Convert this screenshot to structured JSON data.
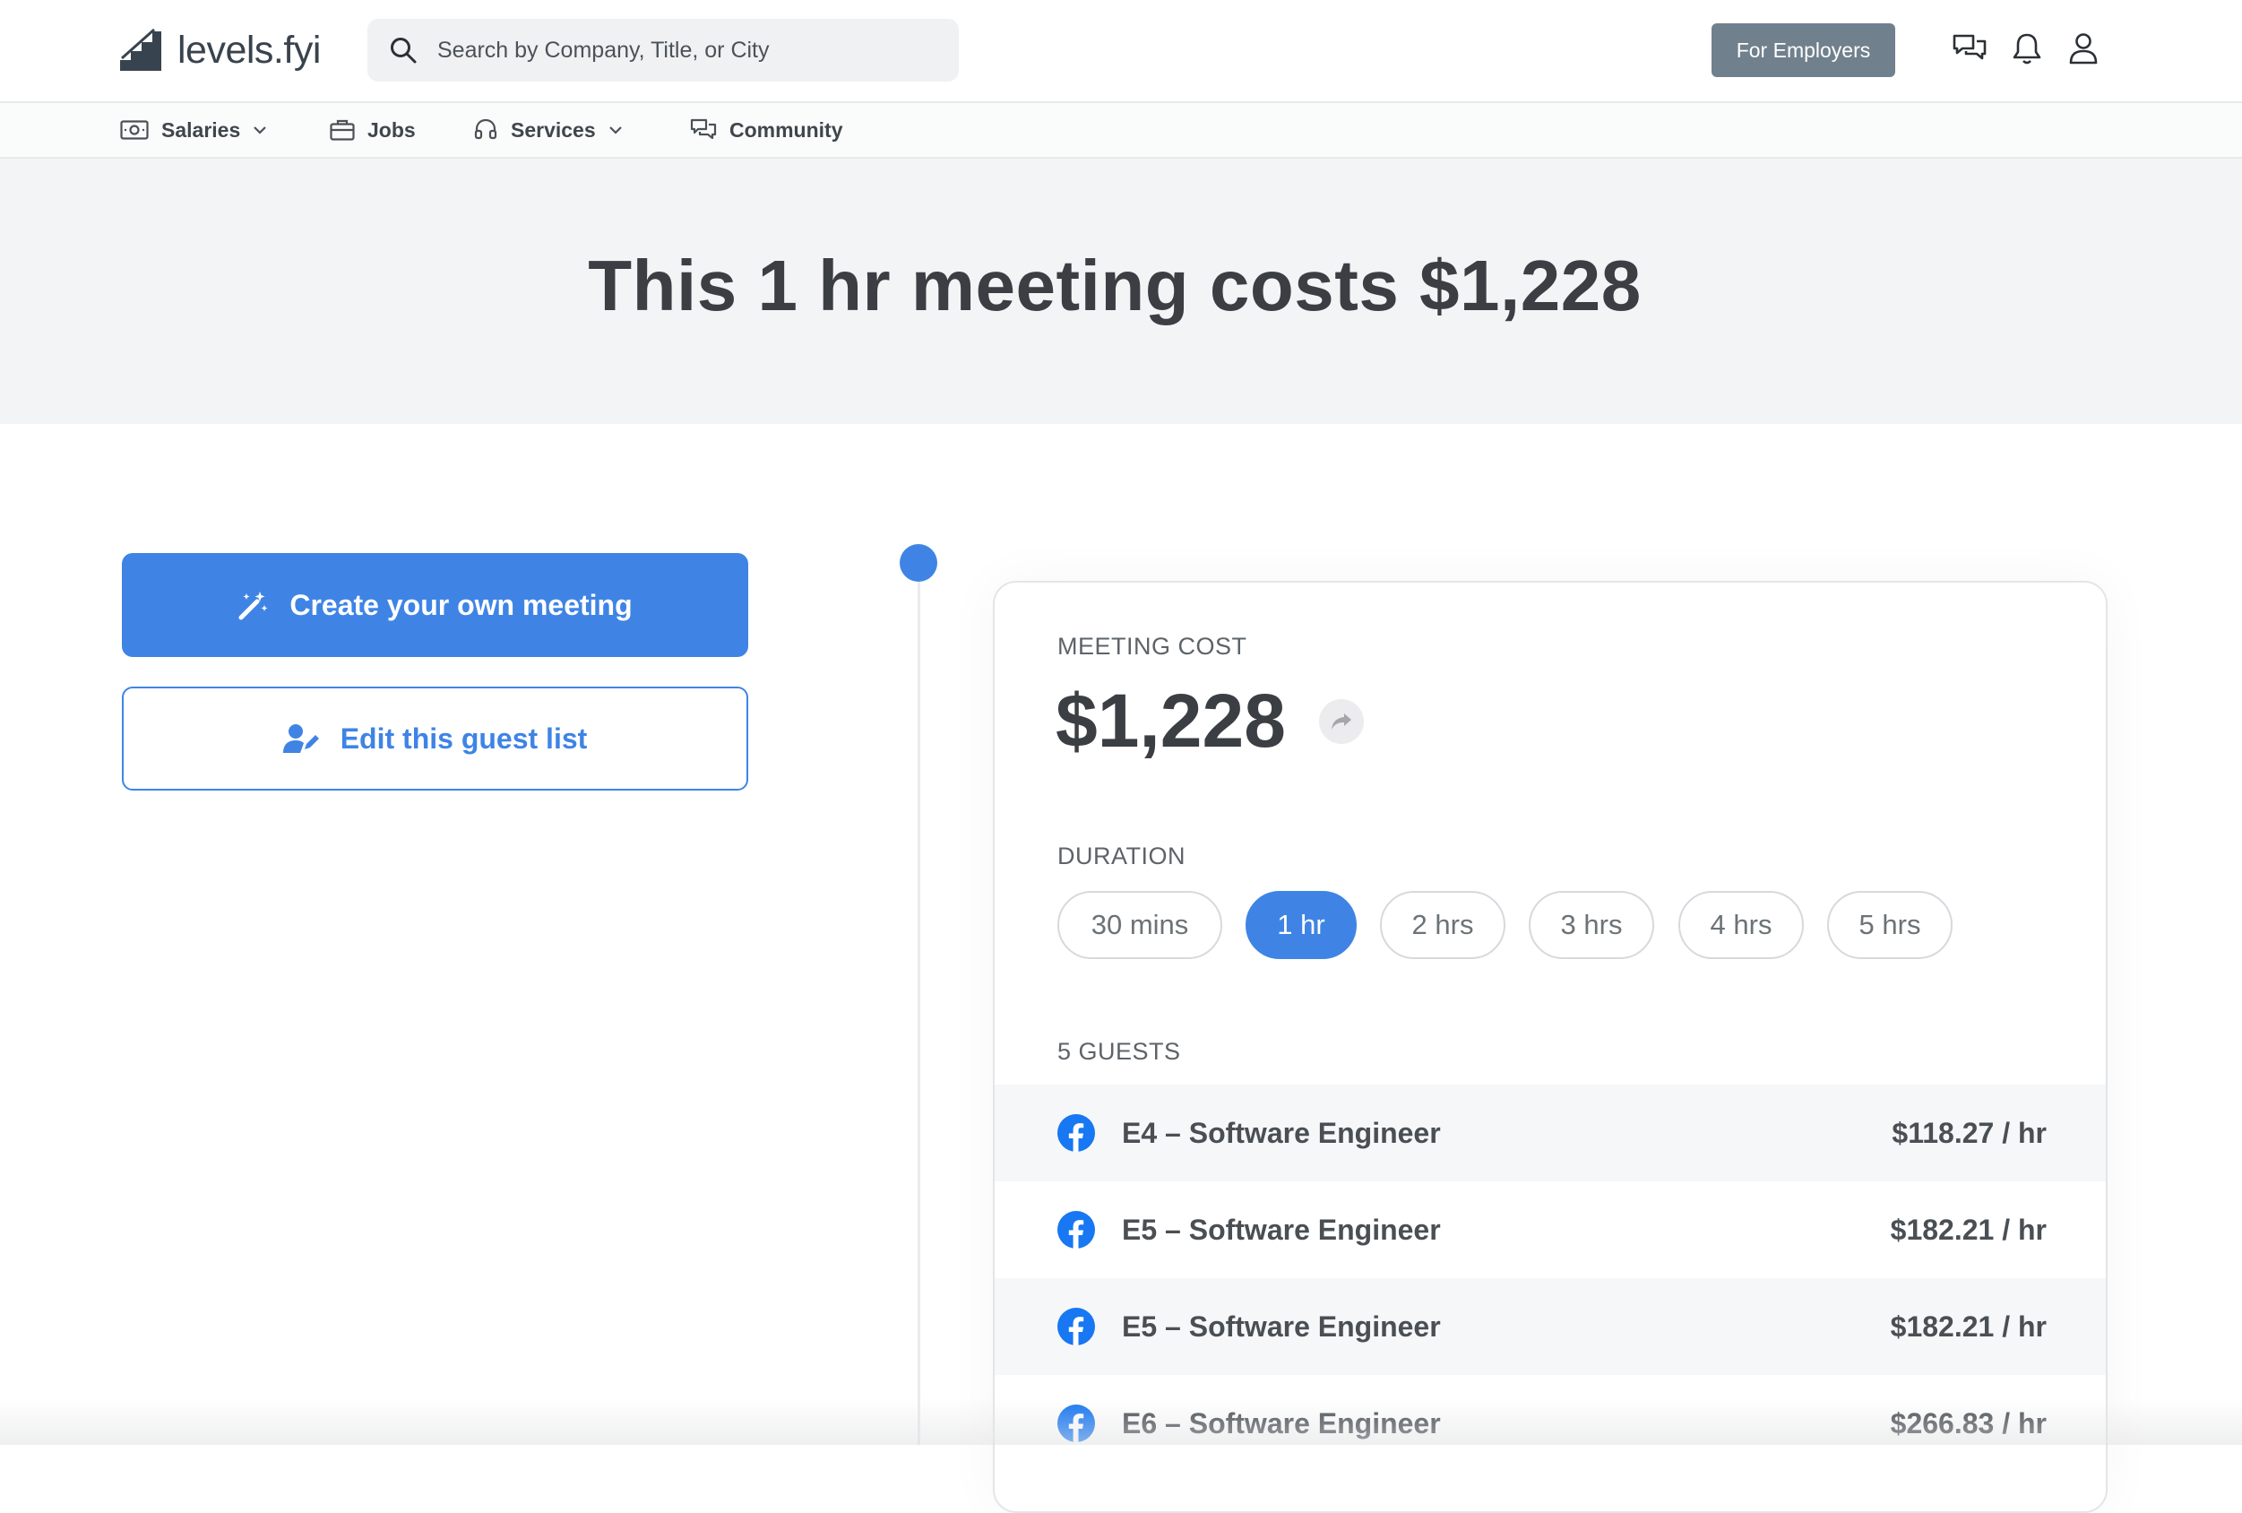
{
  "header": {
    "logo_text": "levels.fyi",
    "search": {
      "placeholder": "Search by Company, Title, or City",
      "value": ""
    },
    "employers_label": "For Employers",
    "icons": [
      "chat-icon",
      "bell-icon",
      "user-icon"
    ]
  },
  "nav": {
    "items": [
      {
        "label": "Salaries",
        "icon": "money-icon",
        "has_dropdown": true
      },
      {
        "label": "Jobs",
        "icon": "briefcase-icon",
        "has_dropdown": false
      },
      {
        "label": "Services",
        "icon": "headset-icon",
        "has_dropdown": true
      },
      {
        "label": "Community",
        "icon": "chat-icon",
        "has_dropdown": false
      }
    ]
  },
  "hero": {
    "title": "This 1 hr meeting costs $1,228"
  },
  "actions": {
    "create_label": "Create your own meeting",
    "edit_label": "Edit this guest list"
  },
  "card": {
    "cost_label": "MEETING COST",
    "cost_value": "$1,228",
    "duration_label": "DURATION",
    "durations": [
      "30 mins",
      "1 hr",
      "2 hrs",
      "3 hrs",
      "4 hrs",
      "5 hrs"
    ],
    "selected_duration": "1 hr",
    "guests_label": "5 GUESTS",
    "guests": [
      {
        "title": "E4 – Software Engineer",
        "rate": "$118.27 / hr"
      },
      {
        "title": "E5 – Software Engineer",
        "rate": "$182.21 / hr"
      },
      {
        "title": "E5 – Software Engineer",
        "rate": "$182.21 / hr"
      },
      {
        "title": "E6 – Software Engineer",
        "rate": "$266.83 / hr"
      }
    ]
  },
  "colors": {
    "accent": "#3f84e5",
    "employers_button": "#71808d",
    "hero_background": "#f3f4f6",
    "facebook": "#1877f2"
  }
}
